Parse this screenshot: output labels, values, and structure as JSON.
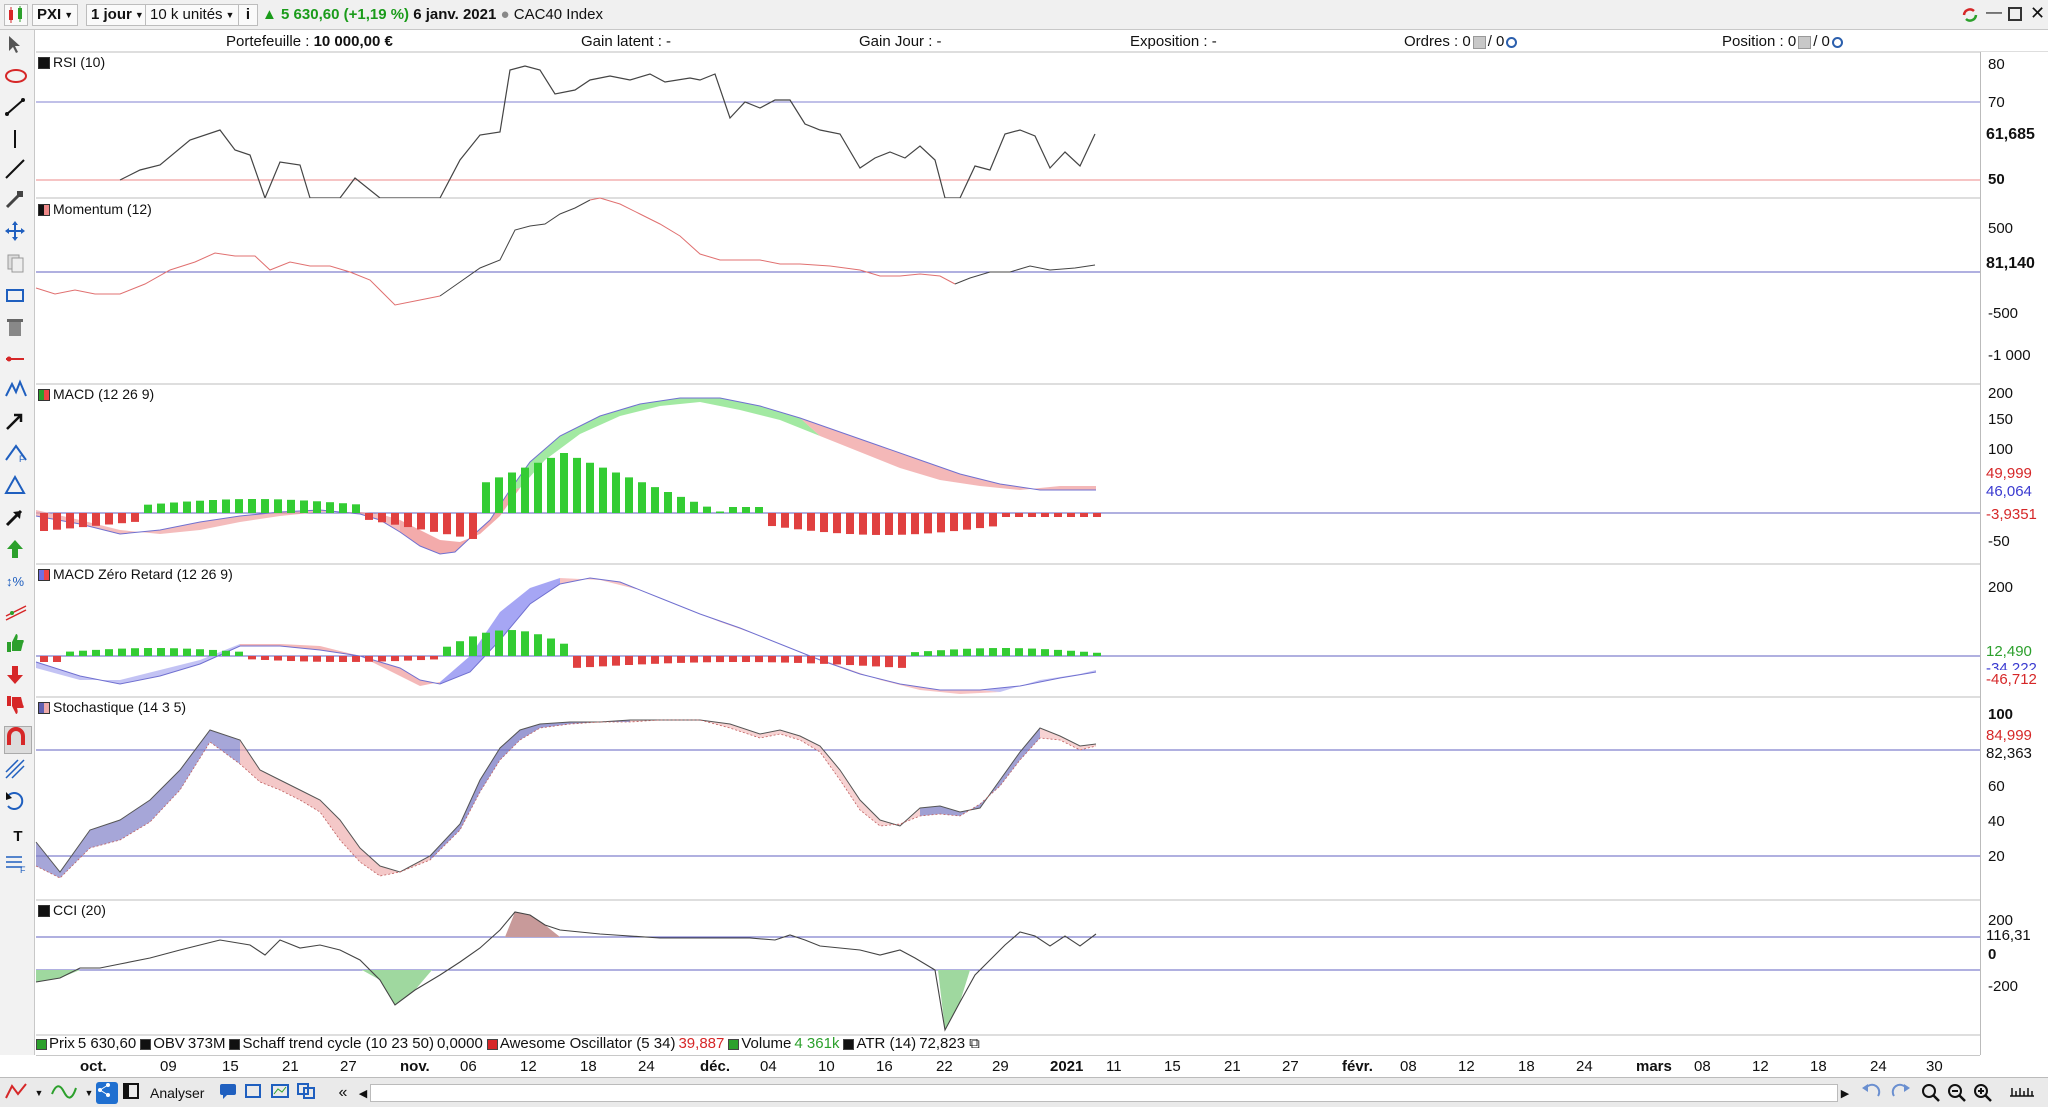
{
  "toolbar": {
    "symbol": "PXI",
    "period": "1 jour",
    "size": "10 k unités",
    "price": "5 630,60",
    "change": "(+1,19 %)",
    "date": "6 janv. 2021",
    "index": "CAC40 Index",
    "price_color": "#1a9b1a"
  },
  "infobar": {
    "portefeuille_label": "Portefeuille :",
    "portefeuille_value": "10 000,00 €",
    "gain_latent": "Gain latent : -",
    "gain_jour": "Gain Jour : -",
    "exposition": "Exposition : -",
    "ordres_label": "Ordres : 0",
    "ordres_after": "/ 0",
    "position_label": "Position : 0",
    "position_after": "/ 0"
  },
  "panels": {
    "rsi": {
      "title": "RSI (10)",
      "ticks": [
        "80",
        "70",
        "50"
      ],
      "last": "61,685"
    },
    "momentum": {
      "title": "Momentum (12)",
      "ticks": [
        "500",
        "-500",
        "-1 000"
      ],
      "last": "81,140"
    },
    "macd": {
      "title": "MACD (12 26 9)",
      "ticks": [
        "200",
        "150",
        "100",
        "-50"
      ],
      "v1": "49,999",
      "v2": "46,064",
      "v3": "-3,9351"
    },
    "macdzr": {
      "title": "MACD Zéro Retard (12 26 9)",
      "ticks": [
        "200"
      ],
      "v1": "12,490",
      "v2": "-34,222",
      "v3": "-46,712"
    },
    "stoch": {
      "title": "Stochastique (14 3 5)",
      "ticks": [
        "100",
        "60",
        "40",
        "20"
      ],
      "v1": "84,999",
      "v2": "82,363"
    },
    "cci": {
      "title": "CCI (20)",
      "ticks": [
        "200",
        "0",
        "-200"
      ],
      "last": "116,31"
    }
  },
  "legend": [
    {
      "name": "Prix",
      "value": "5 630,60",
      "color": "#2ca02c"
    },
    {
      "name": "OBV",
      "value": "373M",
      "color": "#111111"
    },
    {
      "name": "Schaff trend cycle (10 23 50)",
      "value": "0,0000",
      "color": "#111111"
    },
    {
      "name": "Awesome Oscillator (5 34)",
      "value": "39,887",
      "color": "#d62728"
    },
    {
      "name": "Volume",
      "value": "4 361k",
      "color": "#2ca02c"
    },
    {
      "name": "ATR (14)",
      "value": "72,823",
      "color": "#111111"
    }
  ],
  "xaxis": [
    {
      "t": "oct.",
      "b": true
    },
    {
      "t": "09"
    },
    {
      "t": "15"
    },
    {
      "t": "21"
    },
    {
      "t": "27"
    },
    {
      "t": "nov.",
      "b": true
    },
    {
      "t": "06"
    },
    {
      "t": "12"
    },
    {
      "t": "18"
    },
    {
      "t": "24"
    },
    {
      "t": "déc.",
      "b": true
    },
    {
      "t": "04"
    },
    {
      "t": "10"
    },
    {
      "t": "16"
    },
    {
      "t": "22"
    },
    {
      "t": "29"
    },
    {
      "t": "2021",
      "b": true
    },
    {
      "t": "11"
    },
    {
      "t": "15"
    },
    {
      "t": "21"
    },
    {
      "t": "27"
    },
    {
      "t": "févr.",
      "b": true
    },
    {
      "t": "08"
    },
    {
      "t": "12"
    },
    {
      "t": "18"
    },
    {
      "t": "24"
    },
    {
      "t": "mars",
      "b": true
    },
    {
      "t": "08"
    },
    {
      "t": "12"
    },
    {
      "t": "18"
    },
    {
      "t": "24"
    },
    {
      "t": "30"
    }
  ],
  "bottom": {
    "analyser": "Analyser"
  }
}
